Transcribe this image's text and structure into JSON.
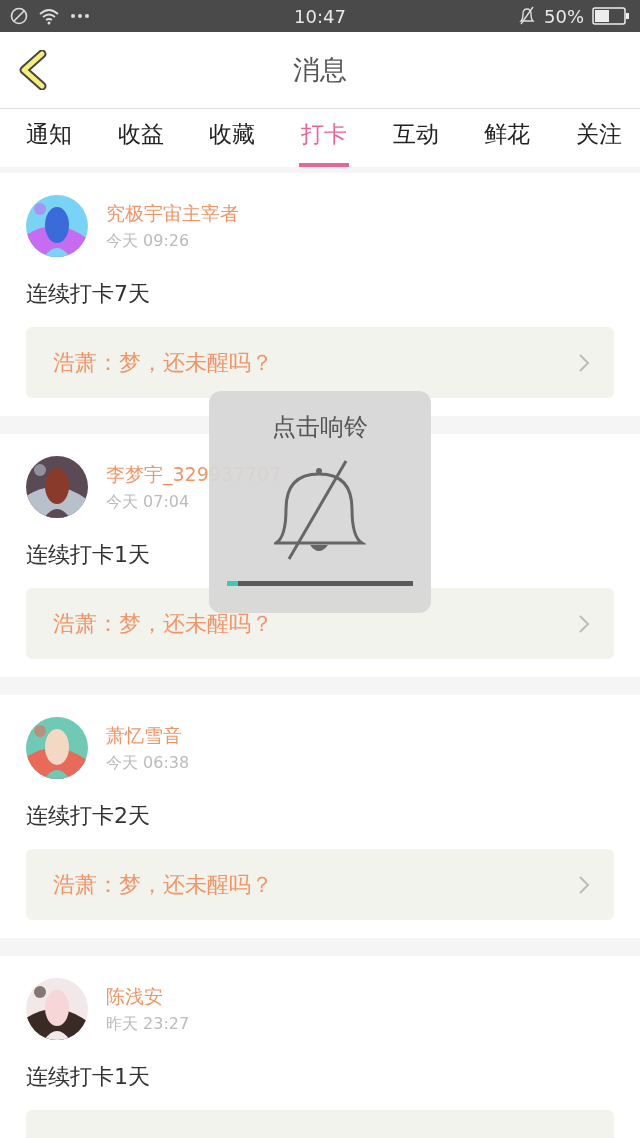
{
  "status_bar": {
    "time": "10:47",
    "battery": "50%"
  },
  "header": {
    "title": "消息"
  },
  "tabs": [
    {
      "label": "通知",
      "selected": false
    },
    {
      "label": "收益",
      "selected": false
    },
    {
      "label": "收藏",
      "selected": false
    },
    {
      "label": "打卡",
      "selected": true
    },
    {
      "label": "互动",
      "selected": false
    },
    {
      "label": "鲜花",
      "selected": false
    },
    {
      "label": "关注",
      "selected": false
    }
  ],
  "messages": [
    {
      "name": "究极宇宙主宰者",
      "time": "今天 09:26",
      "content": "连续打卡7天",
      "reply": "浩萧：梦，还未醒吗？"
    },
    {
      "name": "李梦宇_329937707",
      "time": "今天 07:04",
      "content": "连续打卡1天",
      "reply": "浩萧：梦，还未醒吗？"
    },
    {
      "name": "萧忆雪音",
      "time": "今天 06:38",
      "content": "连续打卡2天",
      "reply": "浩萧：梦，还未醒吗？"
    },
    {
      "name": "陈浅安",
      "time": "昨天 23:27",
      "content": "连续打卡1天"
    }
  ],
  "toast": {
    "title": "点击响铃",
    "level": 0.06
  }
}
